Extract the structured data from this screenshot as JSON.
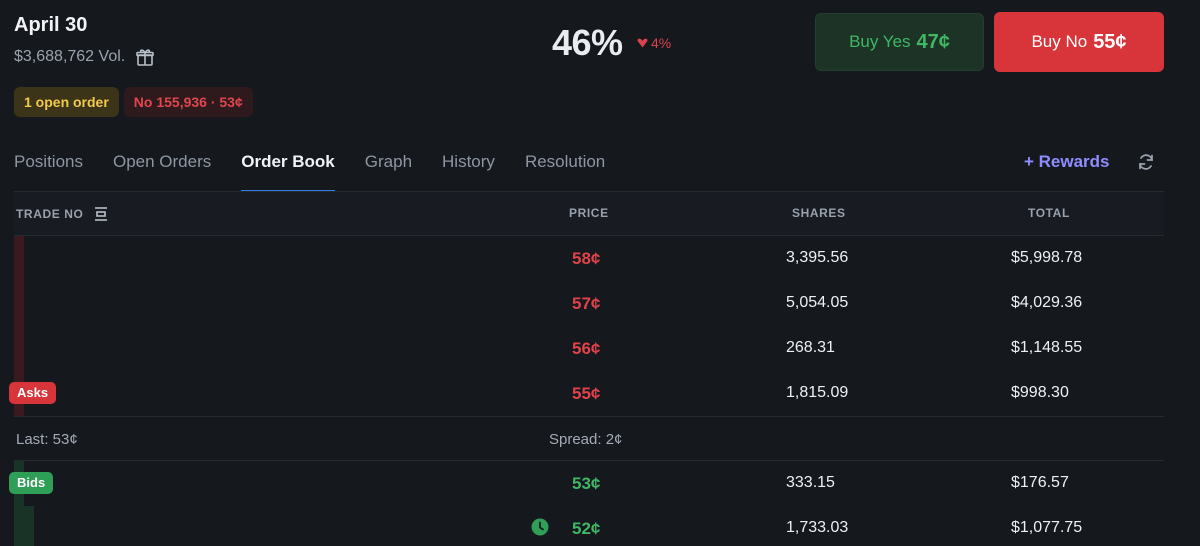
{
  "market": {
    "title": "April 30",
    "volume": "$3,688,762 Vol.",
    "open_order_badge": "1 open order",
    "position_badge": "No 155,936 · 53¢",
    "probability": "46%",
    "change": "4%"
  },
  "buttons": {
    "yes_label": "Buy Yes",
    "yes_price": "47¢",
    "no_label": "Buy No",
    "no_price": "55¢"
  },
  "tabs": [
    {
      "label": "Positions"
    },
    {
      "label": "Open Orders"
    },
    {
      "label": "Order Book",
      "active": true
    },
    {
      "label": "Graph"
    },
    {
      "label": "History"
    },
    {
      "label": "Resolution"
    }
  ],
  "rewards_label": "+ Rewards",
  "table": {
    "headers": {
      "trade": "TRADE NO",
      "price": "PRICE",
      "shares": "SHARES",
      "total": "TOTAL"
    },
    "asks_label": "Asks",
    "bids_label": "Bids",
    "asks": [
      {
        "price": "58¢",
        "shares": "3,395.56",
        "total": "$5,998.78"
      },
      {
        "price": "57¢",
        "shares": "5,054.05",
        "total": "$4,029.36"
      },
      {
        "price": "56¢",
        "shares": "268.31",
        "total": "$1,148.55"
      },
      {
        "price": "55¢",
        "shares": "1,815.09",
        "total": "$998.30"
      }
    ],
    "last": "Last: 53¢",
    "spread": "Spread: 2¢",
    "bids": [
      {
        "price": "53¢",
        "shares": "333.15",
        "total": "$176.57"
      },
      {
        "price": "52¢",
        "shares": "1,733.03",
        "total": "$1,077.75"
      }
    ]
  },
  "colors": {
    "ask": "#e0424a",
    "bid": "#3fb765",
    "accent": "#2f7de1",
    "rewards": "#8f8dff"
  }
}
